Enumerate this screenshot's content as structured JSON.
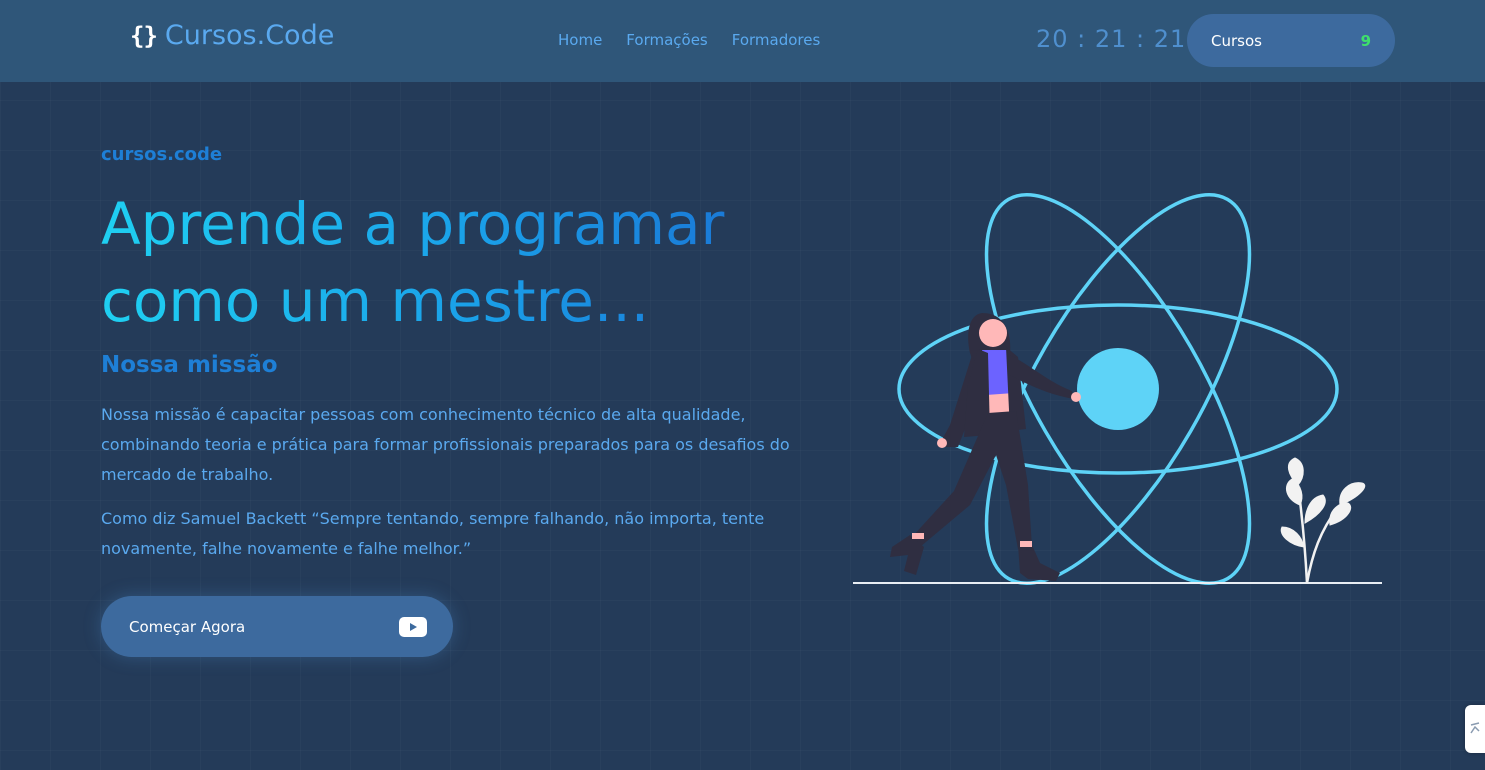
{
  "header": {
    "logo_icon": "{}",
    "logo_text": "Cursos.Code",
    "nav": [
      "Home",
      "Formações",
      "Formadores"
    ],
    "clock": "20 : 21 : 21",
    "cursos_button": {
      "label": "Cursos",
      "count": "9"
    }
  },
  "hero": {
    "eyebrow": "cursos.code",
    "headline_line1": "Aprende a programar",
    "headline_line2": "como um mestre...",
    "mission_title": "Nossa missão",
    "paragraph1": "Nossa missão é capacitar pessoas com conhecimento técnico de alta qualidade, combinando teoria e prática para formar profissionais preparados para os desafios do mercado de trabalho.",
    "paragraph2": "Como diz Samuel Backett “Sempre tentando, sempre falhando, não importa, tente novamente, falhe novamente e falhe melhor.”",
    "cta_label": "Começar Agora",
    "cta_icon": "youtube-icon"
  },
  "colors": {
    "background": "#243b59",
    "header": "#2f5679",
    "accent": "#5aa9ef",
    "button": "#3d6a9e",
    "count": "#3ee06b",
    "atom": "#5ed3f7"
  },
  "illustration": "woman-atom-illustration"
}
